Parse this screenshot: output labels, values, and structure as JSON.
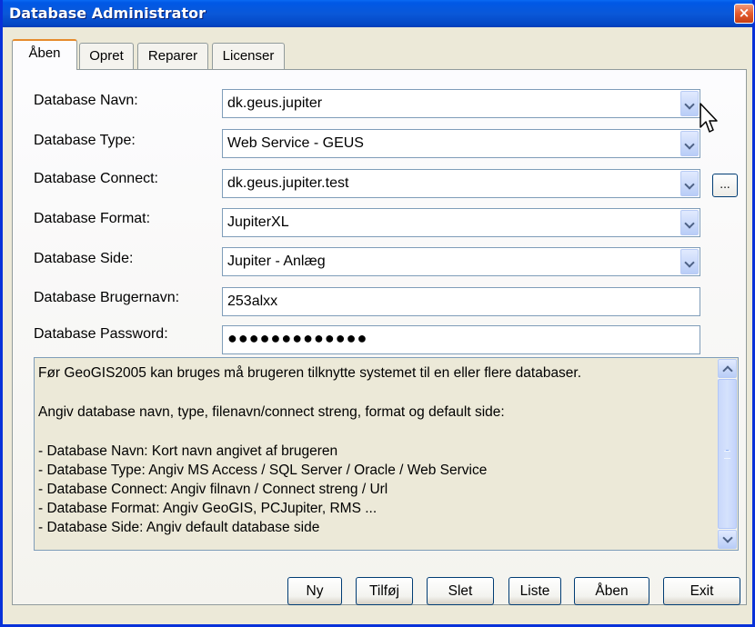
{
  "window": {
    "title": "Database Administrator",
    "close_glyph": "×"
  },
  "tabs": [
    {
      "label": "Åben",
      "active": true
    },
    {
      "label": "Opret",
      "active": false
    },
    {
      "label": "Reparer",
      "active": false
    },
    {
      "label": "Licenser",
      "active": false
    }
  ],
  "fields": {
    "navn": {
      "label": "Database Navn:",
      "value": "dk.geus.jupiter"
    },
    "type": {
      "label": "Database Type:",
      "value": "Web Service - GEUS"
    },
    "connect": {
      "label": "Database Connect:",
      "value": "dk.geus.jupiter.test",
      "browse_label": "..."
    },
    "format": {
      "label": "Database Format:",
      "value": "JupiterXL"
    },
    "side": {
      "label": "Database Side:",
      "value": "Jupiter - Anlæg"
    },
    "brugernavn": {
      "label": "Database Brugernavn:",
      "value": "253alxx"
    },
    "password": {
      "label": "Database Password:",
      "value": "●●●●●●●●●●●●●"
    }
  },
  "help_text": [
    "Før GeoGIS2005 kan bruges må brugeren tilknytte systemet til en eller flere databaser.",
    "",
    "Angiv database navn, type, filenavn/connect streng, format og default side:",
    "",
    "- Database Navn: Kort navn angivet af brugeren",
    "- Database Type: Angiv MS Access / SQL Server / Oracle / Web Service",
    "- Database Connect: Angiv filnavn / Connect streng / Url",
    "- Database Format: Angiv GeoGIS, PCJupiter, RMS ...",
    "- Database Side: Angiv default database side"
  ],
  "buttons": {
    "ny": "Ny",
    "tilfoj": "Tilføj",
    "slet": "Slet",
    "liste": "Liste",
    "aaben": "Åben",
    "exit": "Exit"
  },
  "colors": {
    "titlebar": "#0058e6",
    "window_bg": "#ece9d8",
    "tab_accent": "#e68b2c",
    "field_border": "#7f9db9"
  }
}
